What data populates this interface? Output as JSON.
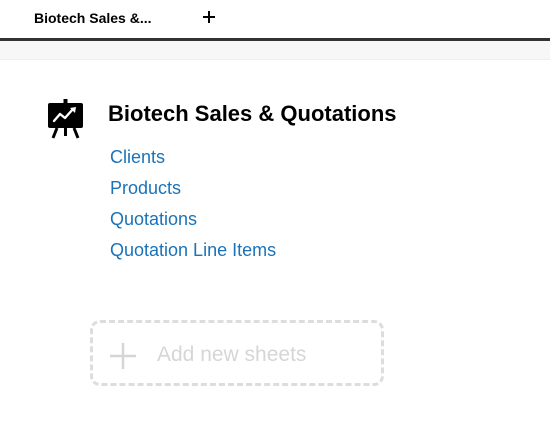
{
  "tabs": [
    {
      "label": "Biotech Sales &..."
    }
  ],
  "app": {
    "title": "Biotech Sales & Quotations",
    "icon": "presentation-chart-icon"
  },
  "sheets": [
    {
      "label": "Clients"
    },
    {
      "label": "Products"
    },
    {
      "label": "Quotations"
    },
    {
      "label": "Quotation Line Items"
    }
  ],
  "add_sheets": {
    "label": "Add new sheets",
    "icon": "plus-icon"
  },
  "colors": {
    "link": "#1a73b8",
    "tab_border": "#333333",
    "dashed_border": "#dddddd",
    "placeholder_text": "#d6d6d6"
  }
}
